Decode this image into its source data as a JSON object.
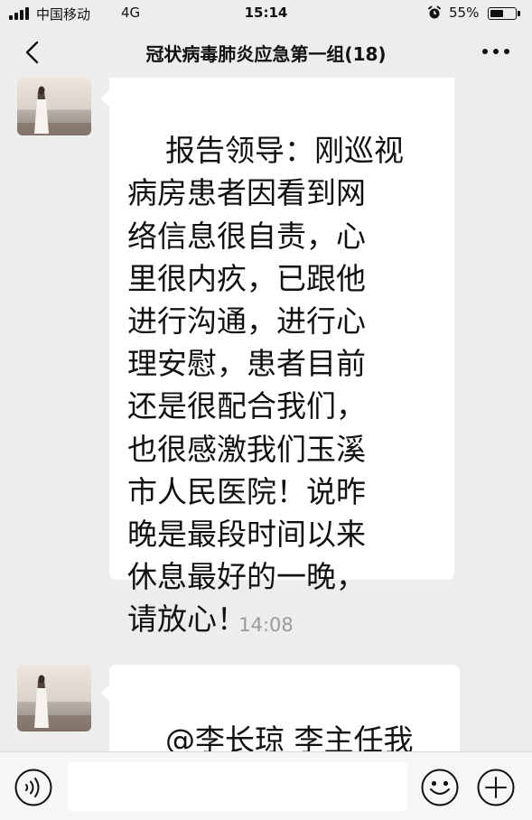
{
  "status_bar": {
    "carrier": "中国移动",
    "network": "4G",
    "time": "15:14",
    "battery_percent_label": "55%",
    "battery_level": 0.55
  },
  "nav": {
    "title": "冠状病毒肺炎应急第一组(18)",
    "back_icon": "chevron-left-icon",
    "more_icon": "more-dots-icon"
  },
  "messages": [
    {
      "text": "报告领导：刚巡视\n病房患者因看到网\n络信息很自责，心\n里很内疚，已跟他\n进行沟通，进行心\n理安慰，患者目前\n还是很配合我们，\n也很感激我们玉溪\n市人民医院！说昨\n晚是最段时间以来\n休息最好的一晚，\n请放心！"
    },
    {
      "text": "@李长琼 李主任我\n们这个医护组有心"
    }
  ],
  "timestamp": "14:08",
  "input_bar": {
    "voice_icon": "voice-icon",
    "emoji_icon": "emoji-icon",
    "plus_icon": "plus-icon",
    "input_value": ""
  }
}
